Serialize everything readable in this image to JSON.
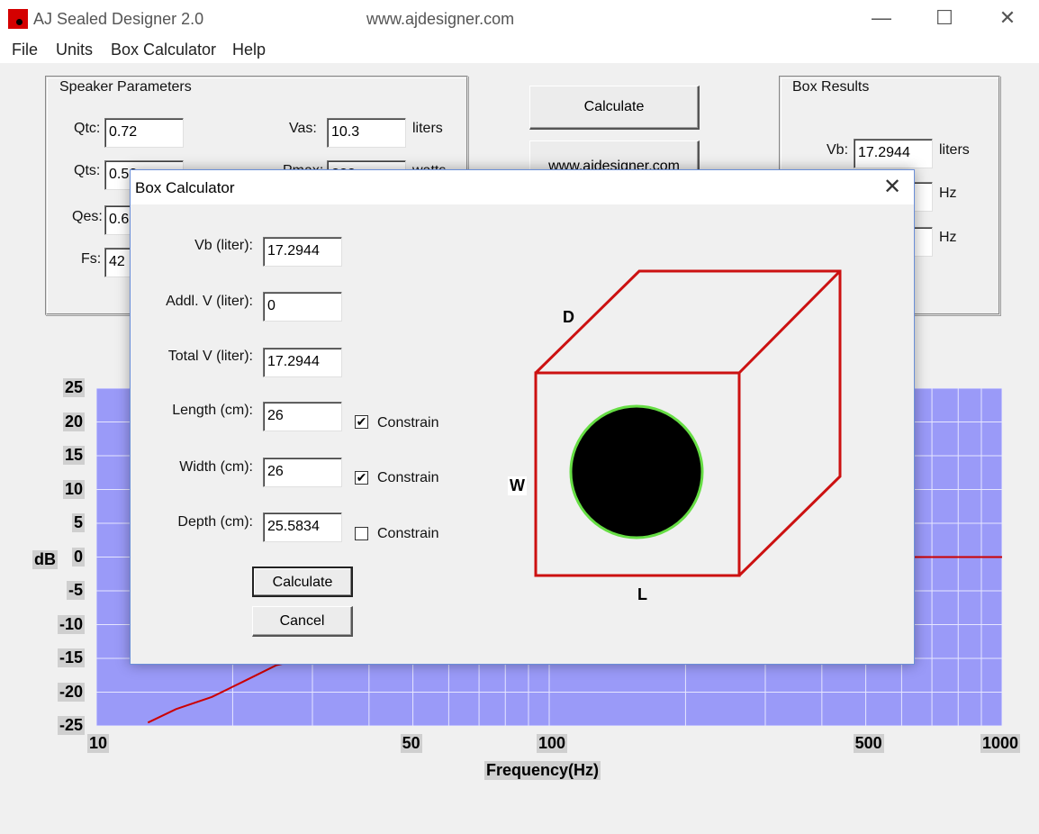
{
  "window": {
    "title": "AJ Sealed Designer 2.0",
    "url": "www.ajdesigner.com",
    "minimize": "—",
    "maximize": "☐",
    "close": "✕"
  },
  "menu": {
    "file": "File",
    "units": "Units",
    "box_calculator": "Box Calculator",
    "help": "Help"
  },
  "speaker_params": {
    "title": "Speaker Parameters",
    "qtc_label": "Qtc:",
    "qtc_value": "0.72",
    "qts_label": "Qts:",
    "qts_value": "0.5?",
    "qes_label": "Qes:",
    "qes_value": "0.6",
    "fs_label": "Fs:",
    "fs_value": "42",
    "vas_label": "Vas:",
    "vas_value": "10.3",
    "vas_unit": "liters",
    "pmax_label": "Pmax:",
    "pmax_value": "???",
    "pmax_unit": "watts"
  },
  "main_buttons": {
    "calculate": "Calculate",
    "website": "www.ajdesigner.com"
  },
  "box_results": {
    "title": "Box Results",
    "vb_label": "Vb:",
    "vb_value": "17.2944",
    "vb_unit": "liters",
    "f3_unit": "Hz",
    "fc_unit": "Hz"
  },
  "chart_data": {
    "type": "line",
    "xlabel": "Frequency(Hz)",
    "ylabel": "dB",
    "xscale": "log",
    "xlim": [
      10,
      1000
    ],
    "ylim": [
      -25,
      25
    ],
    "xticks": [
      "10",
      "50",
      "100",
      "500",
      "1000"
    ],
    "yticks": [
      "25",
      "20",
      "15",
      "10",
      "5",
      "0",
      "-5",
      "-10",
      "-15",
      "-20",
      "-25"
    ],
    "grid": true,
    "series": [
      {
        "x": [
          13,
          15,
          18,
          21,
          25,
          250,
          400,
          600,
          1000
        ],
        "y": [
          -24.5,
          -22.5,
          -20.7,
          -18.5,
          -16,
          -0.3,
          0,
          0,
          0
        ]
      }
    ],
    "colors": {
      "plot_bg": "#9a9af8",
      "line": "#cc0000",
      "grid": "#e6e6ff"
    }
  },
  "dialog": {
    "title": "Box Calculator",
    "close": "✕",
    "vb_label": "Vb (liter):",
    "vb_value": "17.2944",
    "addl_label": "Addl. V (liter):",
    "addl_value": "0",
    "total_label": "Total V (liter):",
    "total_value": "17.2944",
    "length_label": "Length (cm):",
    "length_value": "26",
    "length_constrain": "Constrain",
    "length_checked": "✔",
    "width_label": "Width (cm):",
    "width_value": "26",
    "width_constrain": "Constrain",
    "width_checked": "✔",
    "depth_label": "Depth (cm):",
    "depth_value": "25.5834",
    "depth_constrain": "Constrain",
    "depth_checked": "",
    "calculate_button": "Calculate",
    "cancel_button": "Cancel",
    "box_labels": {
      "depth": "D",
      "width": "W",
      "length": "L"
    }
  }
}
